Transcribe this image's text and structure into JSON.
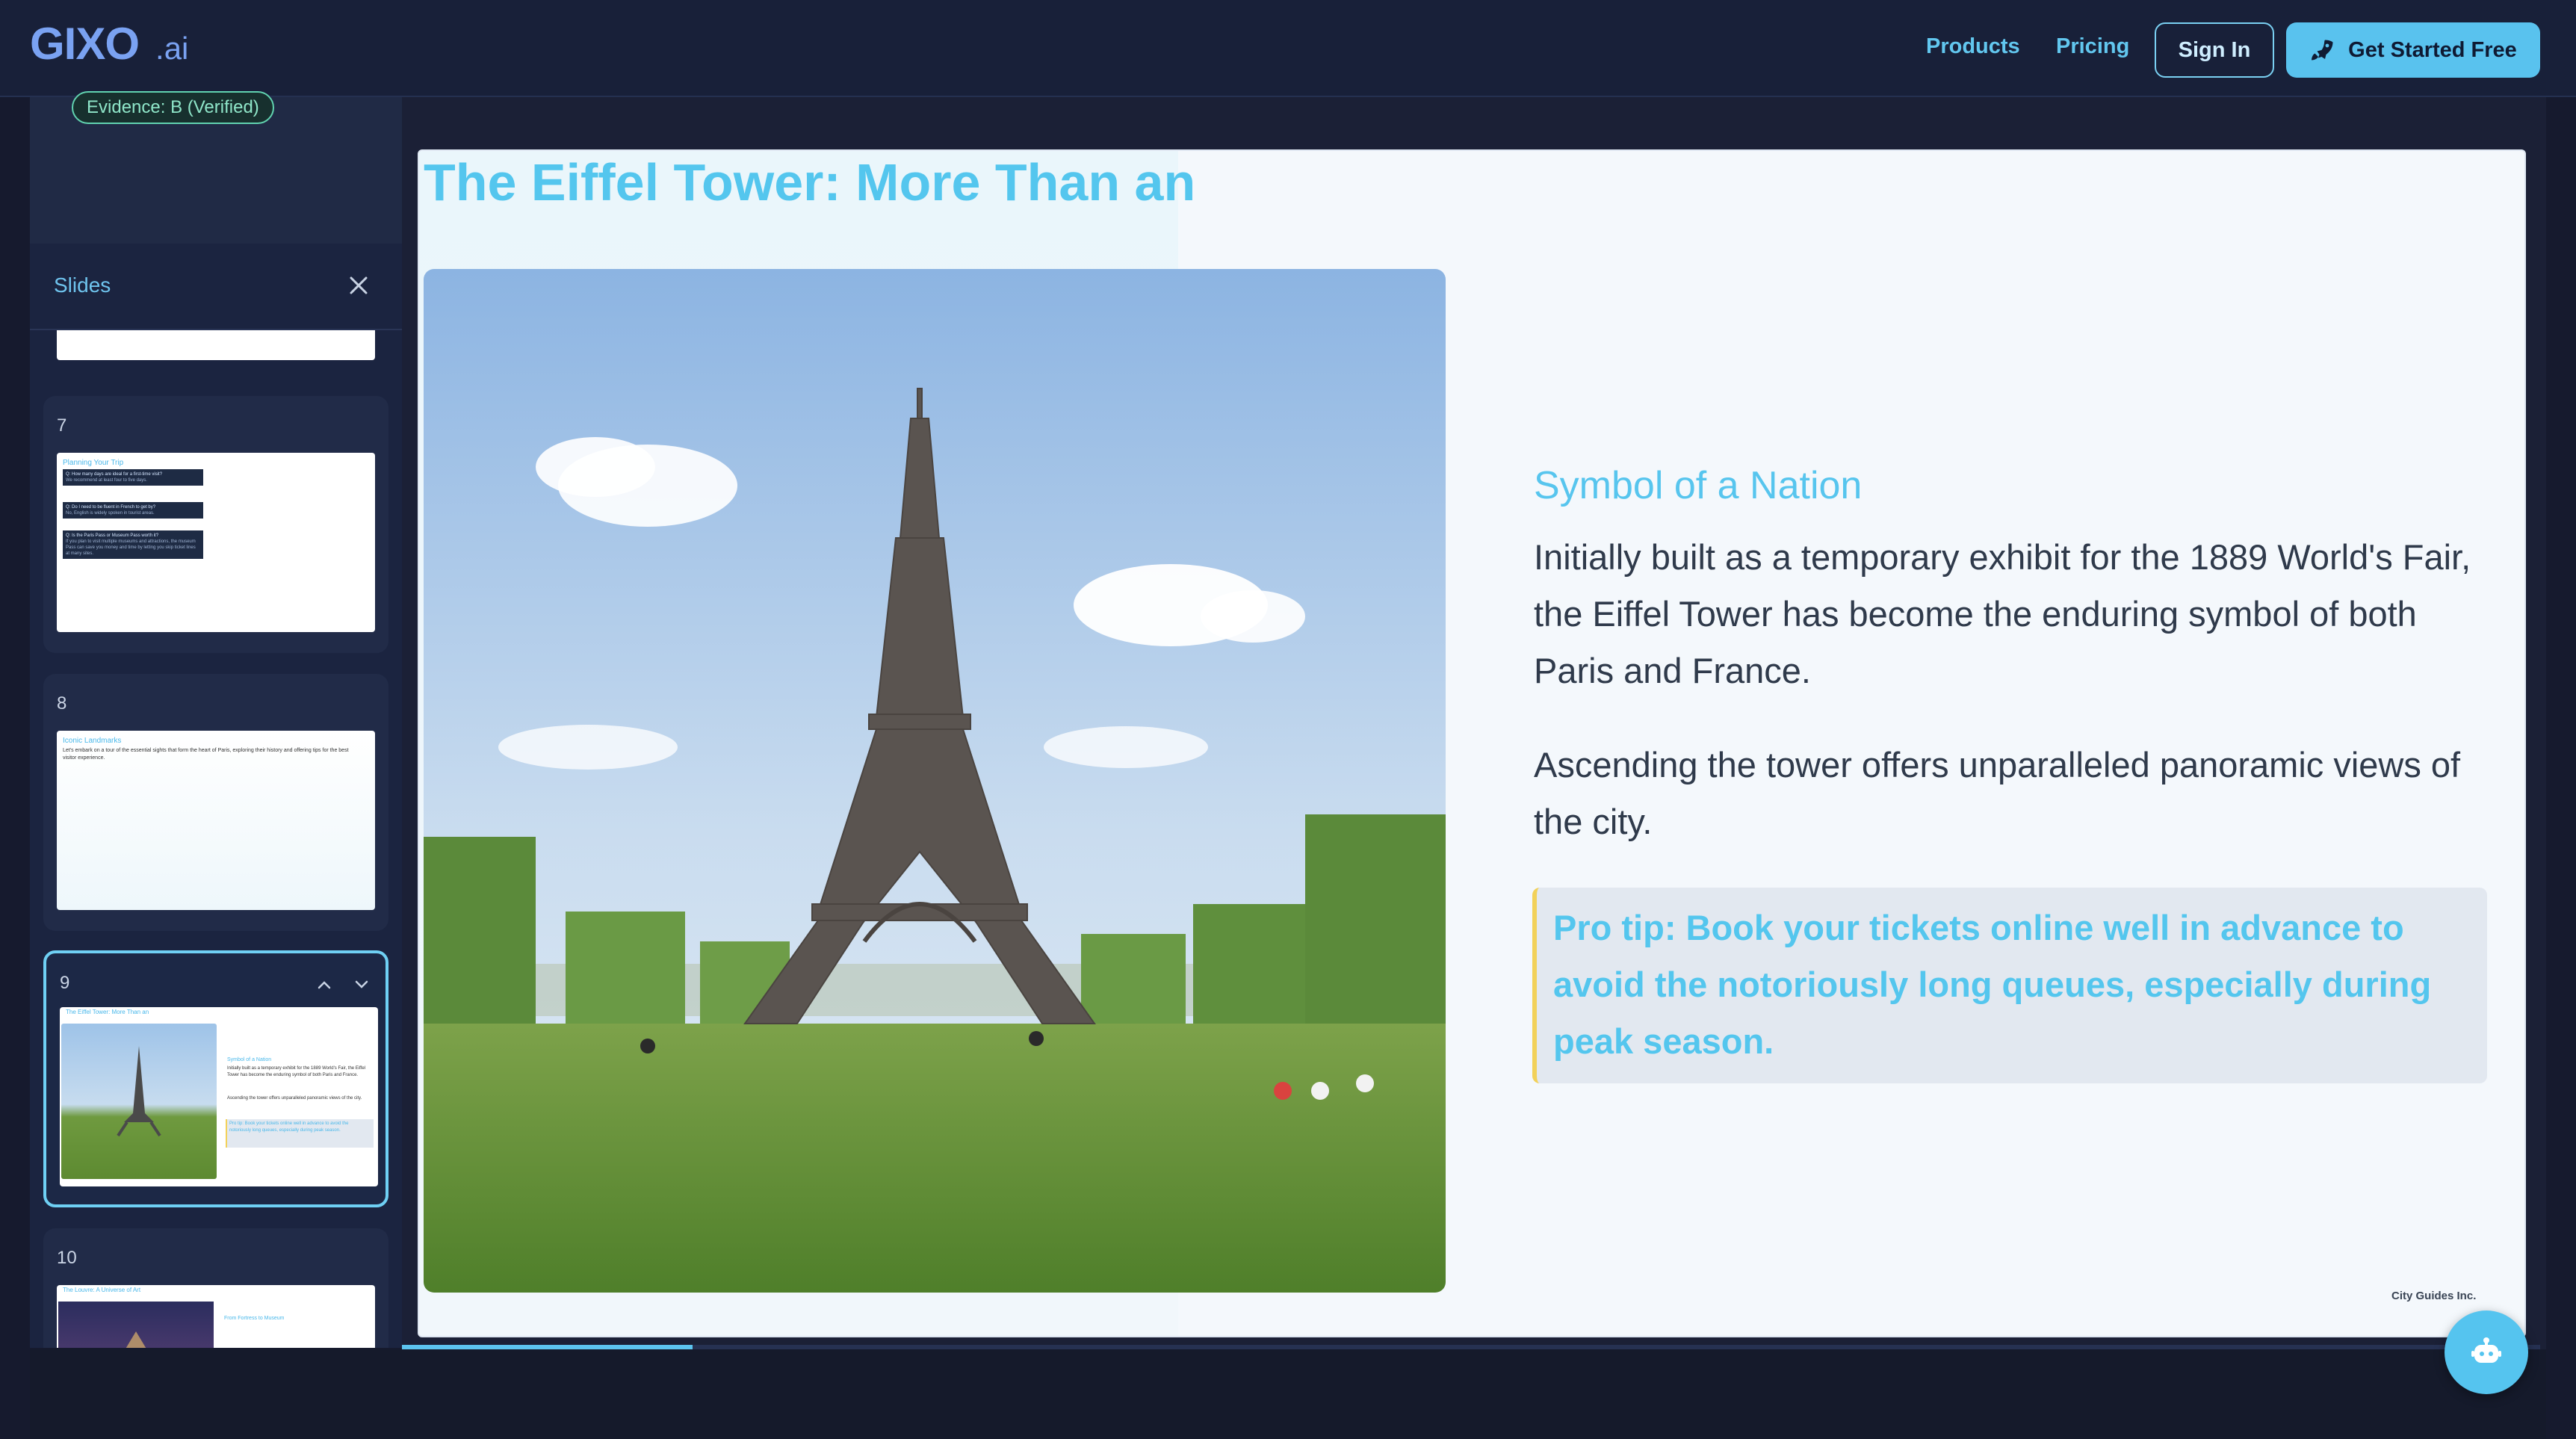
{
  "nav": {
    "logo_main": "GIXO",
    "logo_suffix": ".ai",
    "products": "Products",
    "pricing": "Pricing",
    "sign_in": "Sign In",
    "get_started": "Get Started Free"
  },
  "evidence_badge": "Evidence: B (Verified)",
  "slides_panel": {
    "title": "Slides",
    "cards": [
      {
        "number": "7",
        "thumb_title": "Planning Your Trip",
        "qa": [
          {
            "q": "Q: How many days are ideal for a first-time visit?",
            "a": "We recommend at least four to five days."
          },
          {
            "q": "Q: Do I need to be fluent in French to get by?",
            "a": "No, English is widely spoken in tourist areas."
          },
          {
            "q": "Q: Is the Paris Pass or Museum Pass worth it?",
            "a": "If you plan to visit multiple museums and attractions, the museum Pass can save you money and time by letting you skip ticket lines at many sites."
          }
        ]
      },
      {
        "number": "8",
        "thumb_title": "Iconic Landmarks",
        "thumb_text": "Let's embark on a tour of the essential sights that form the heart of Paris, exploring their history and offering tips for the best visitor experience."
      },
      {
        "number": "9",
        "thumb_title": "The Eiffel Tower: More Than an",
        "thumb_heading": "Symbol of a Nation",
        "thumb_text": "Initially built as a temporary exhibit for the 1889 World's Fair, the Eiffel Tower has become the enduring symbol of both Paris and France.",
        "thumb_text2": "Ascending the tower offers unparalleled panoramic views of the city.",
        "thumb_tip": "Pro tip: Book your tickets online well in advance to avoid the notoriously long queues, especially during peak season."
      },
      {
        "number": "10",
        "thumb_title": "The Louvre: A Universe of Art",
        "thumb_heading": "From Fortress to Museum"
      }
    ]
  },
  "slide": {
    "title": "The Eiffel Tower: More Than an",
    "heading": "Symbol of a Nation",
    "paragraph1": "Initially built as a temporary exhibit for the 1889 World's Fair, the Eiffel Tower has become the enduring symbol of both Paris and France.",
    "paragraph2": "Ascending the tower offers unparalleled panoramic views of the city.",
    "tip": "Pro tip: Book your tickets online well in advance to avoid the notoriously long queues, especially during peak season.",
    "footer": "City Guides Inc."
  },
  "progress_fraction": 0.136,
  "colors": {
    "accent": "#54c6ee",
    "nav_bg": "#182039",
    "tip_border": "#f2d159"
  },
  "icons": {
    "close": "close-icon",
    "rocket": "rocket-icon",
    "chevron_up": "chevron-up-icon",
    "chevron_down": "chevron-down-icon",
    "chat": "chat-bot-icon"
  }
}
